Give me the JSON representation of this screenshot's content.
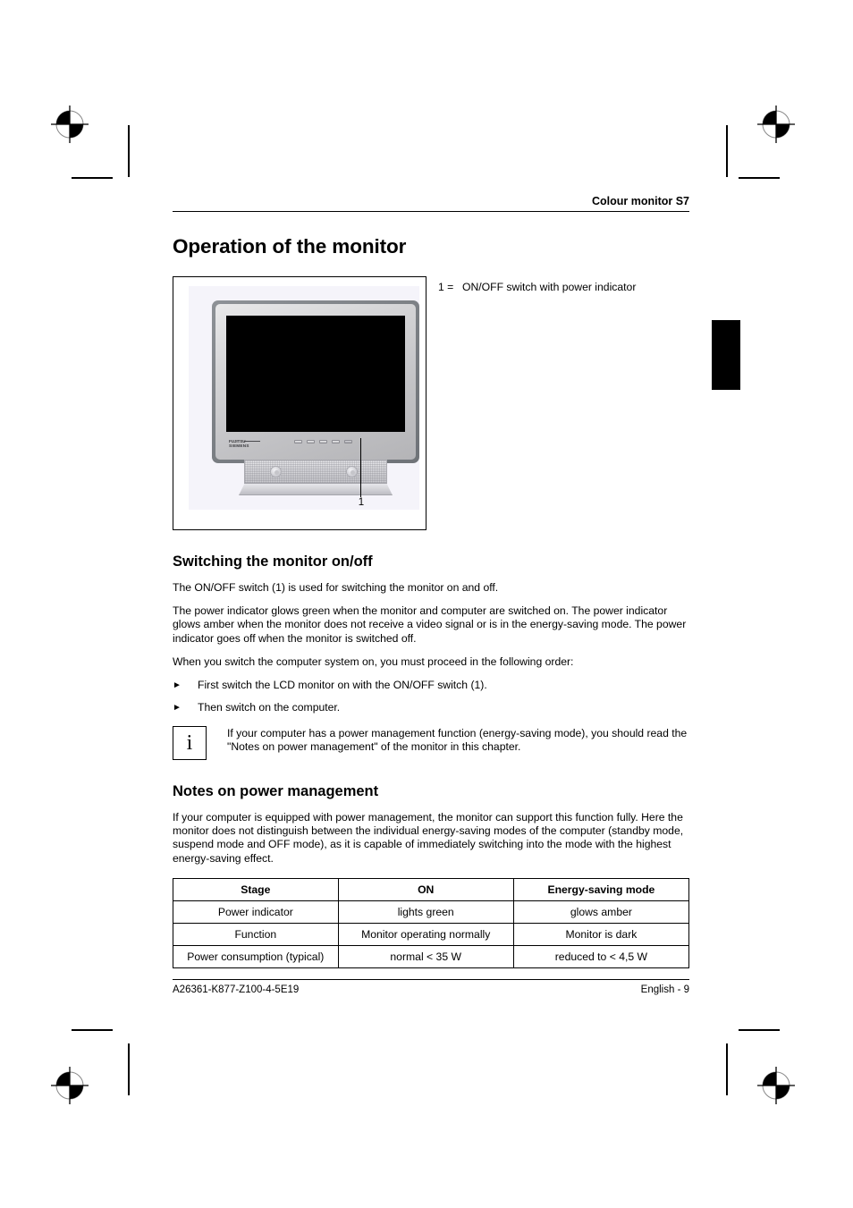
{
  "header": {
    "running_head": "Colour monitor S7"
  },
  "chapter": {
    "title": "Operation of the monitor"
  },
  "figure": {
    "legend_key": "1 =",
    "legend_text": "ON/OFF switch with power indicator",
    "callout_number": "1",
    "monitor_brand_line1": "FUJITSU",
    "monitor_brand_line2": "SIEMENS"
  },
  "switching": {
    "heading": "Switching the monitor on/off",
    "p1": "The ON/OFF switch (1) is used for switching the monitor on and off.",
    "p2": "The power indicator glows green when the monitor and computer are switched on. The power indicator glows amber when the monitor does not receive a video signal or is in the energy-saving mode. The power indicator goes off when the monitor is switched off.",
    "p3": "When you switch the computer system on, you must proceed in the following order:",
    "steps": [
      {
        "glyph": "►",
        "text": "First switch the LCD monitor on with the ON/OFF switch (1)."
      },
      {
        "glyph": "►",
        "text": "Then switch on the computer."
      }
    ],
    "note": {
      "icon": "i",
      "text": "If your computer has a power management function (energy-saving mode), you should read the \"Notes on power management\" of the monitor in this chapter."
    }
  },
  "power_management": {
    "heading": "Notes on power management",
    "p1": "If your computer is equipped with power management, the monitor can support this function fully. Here the monitor does not distinguish between the individual energy-saving modes of the computer (standby mode, suspend mode and OFF mode), as it is capable of immediately switching into the mode with the highest energy-saving effect.",
    "table": {
      "headers": [
        "Stage",
        "ON",
        "Energy-saving mode"
      ],
      "rows": [
        [
          "Power indicator",
          "lights green",
          "glows amber"
        ],
        [
          "Function",
          "Monitor operating normally",
          "Monitor is dark"
        ],
        [
          "Power consumption (typical)",
          "normal < 35 W",
          "reduced to < 4,5 W"
        ]
      ]
    }
  },
  "footer": {
    "part_number": "A26361-K877-Z100-4-5E19",
    "page_label": "English - 9"
  },
  "colors": {
    "page_background": "#ffffff",
    "text": "#000000",
    "figure_panel": "#f5f4fa",
    "screen": "#000000",
    "thumb_tab": "#000000"
  }
}
